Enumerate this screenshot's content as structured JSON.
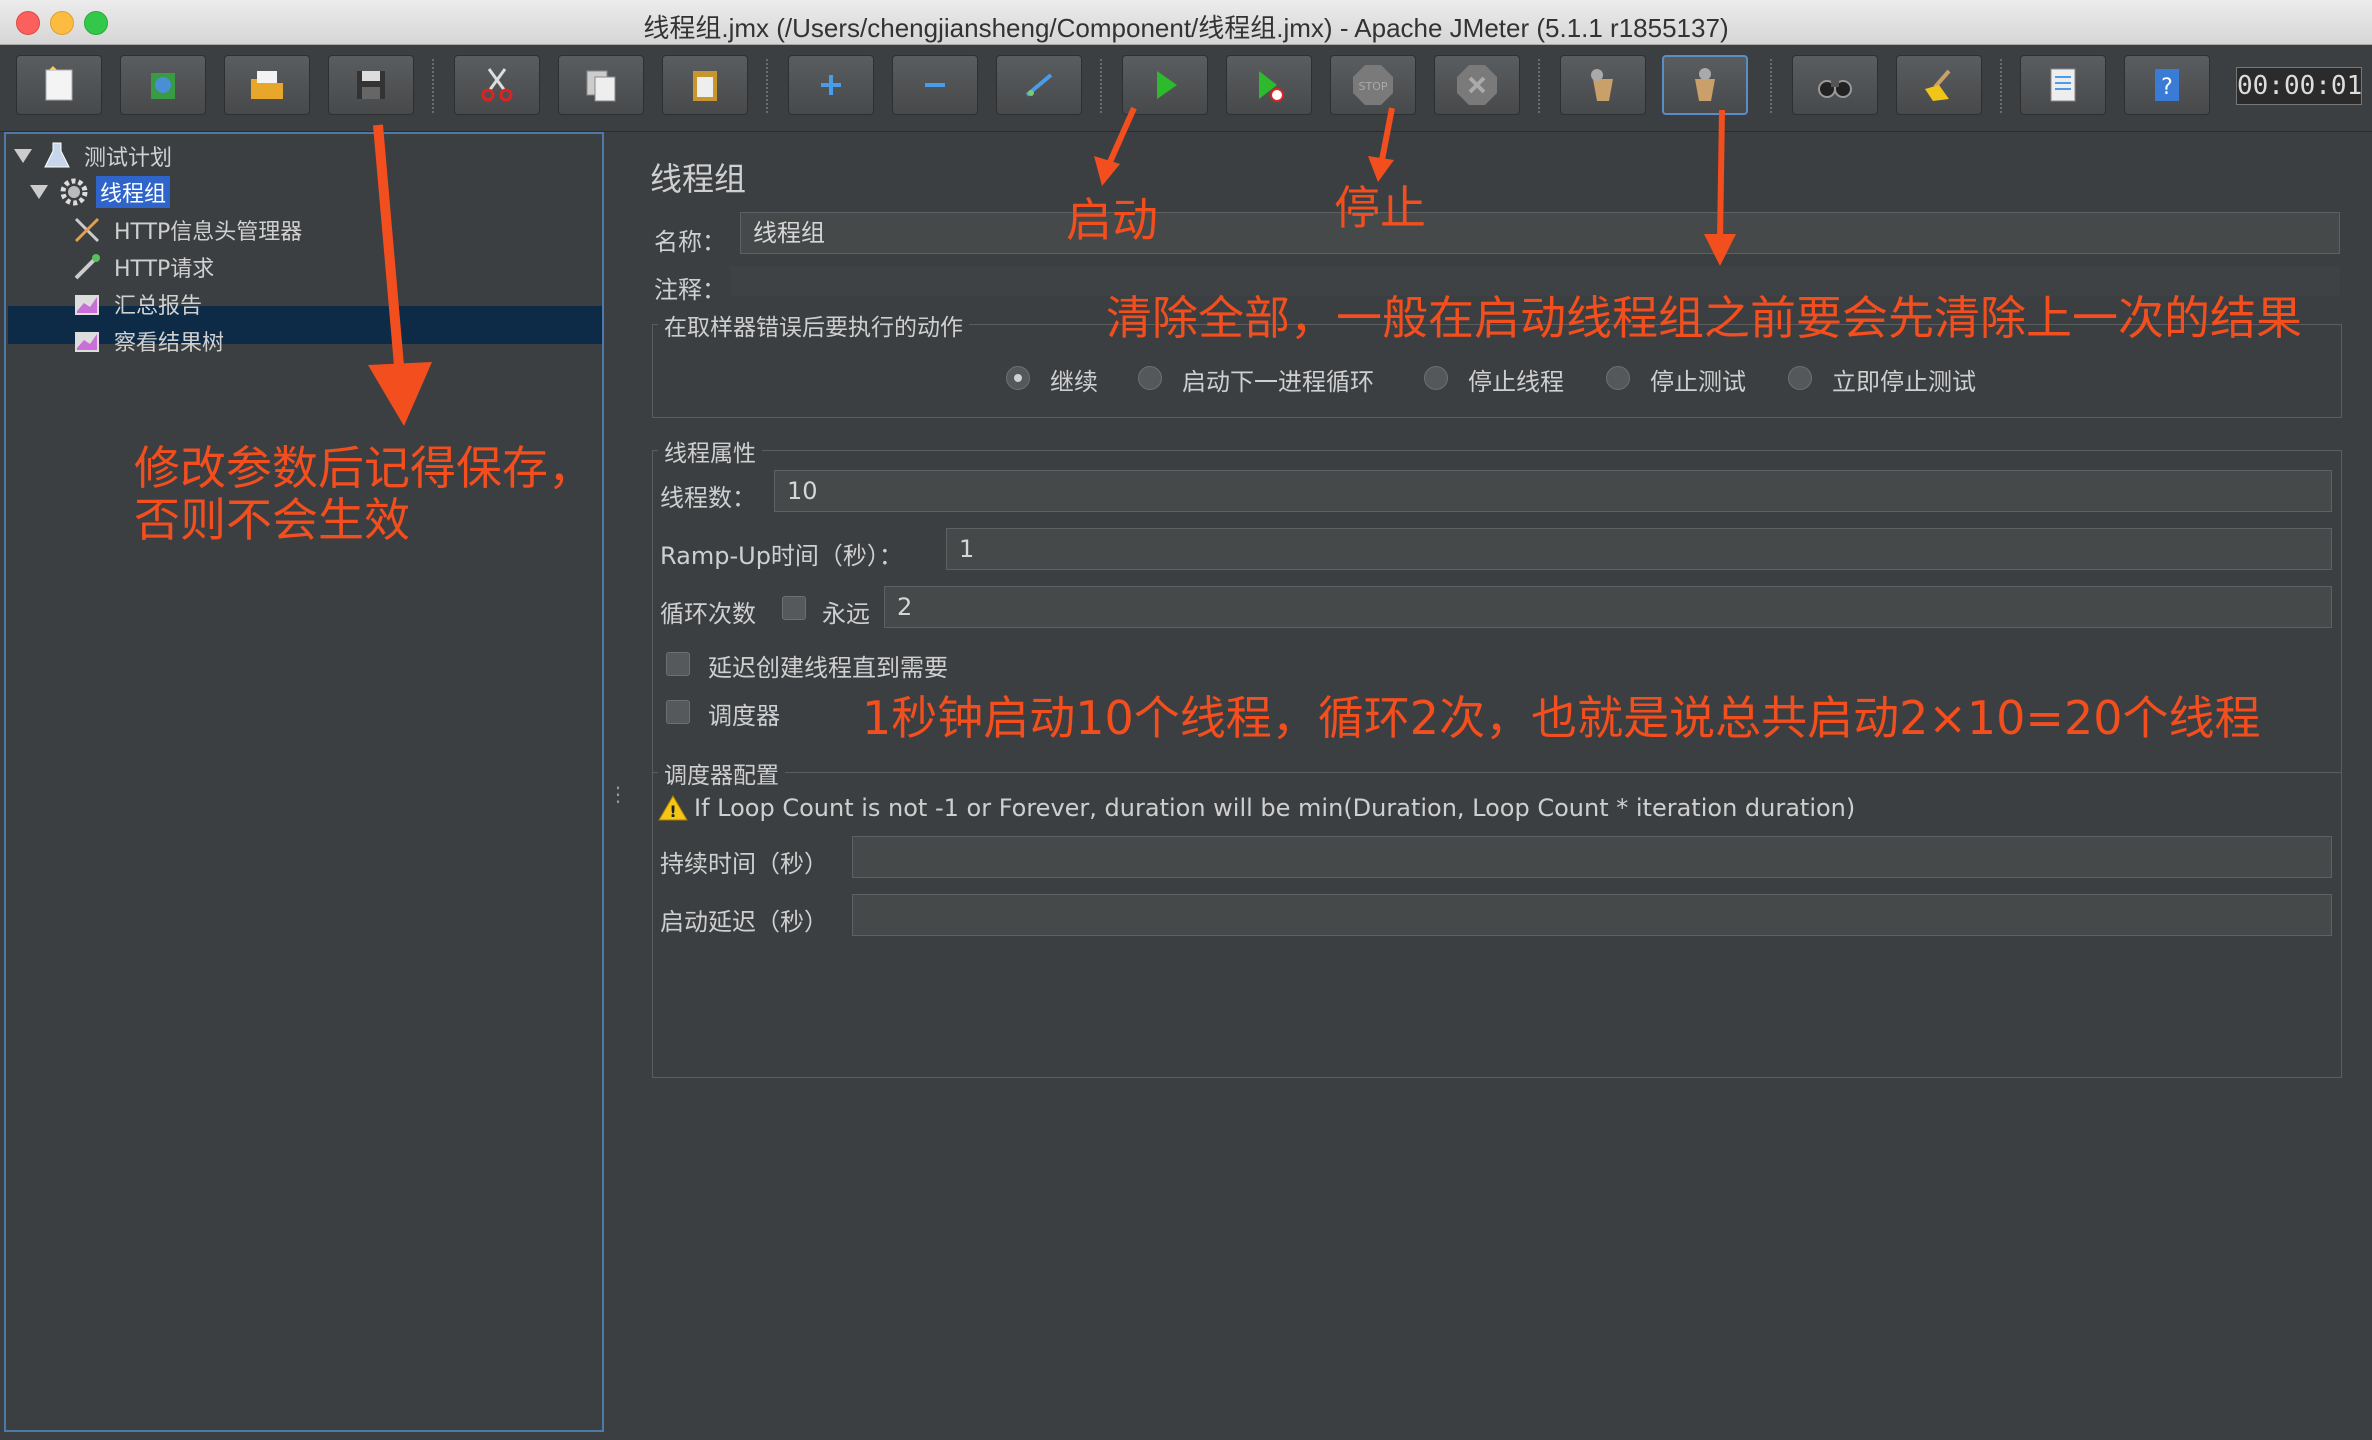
{
  "window": {
    "title": "线程组.jmx (/Users/chengjiansheng/Component/线程组.jmx) - Apache JMeter (5.1.1 r1855137)"
  },
  "toolbar": {
    "timer": "00:00:01",
    "buttons": [
      {
        "name": "new-icon"
      },
      {
        "name": "templates-icon"
      },
      {
        "name": "open-icon"
      },
      {
        "name": "save-icon"
      },
      {
        "name": "cut-icon"
      },
      {
        "name": "copy-icon"
      },
      {
        "name": "paste-icon"
      },
      {
        "name": "expand-icon"
      },
      {
        "name": "collapse-icon"
      },
      {
        "name": "toggle-icon"
      },
      {
        "name": "start-icon"
      },
      {
        "name": "start-no-pauses-icon"
      },
      {
        "name": "stop-icon"
      },
      {
        "name": "shutdown-icon"
      },
      {
        "name": "clear-icon"
      },
      {
        "name": "clear-all-icon"
      },
      {
        "name": "search-icon"
      },
      {
        "name": "reset-search-icon"
      },
      {
        "name": "function-helper-icon"
      },
      {
        "name": "help-icon"
      }
    ]
  },
  "tree": {
    "items": [
      {
        "label": "测试计划",
        "icon": "flask-icon"
      },
      {
        "label": "线程组",
        "icon": "gear-icon"
      },
      {
        "label": "HTTP信息头管理器",
        "icon": "tools-icon"
      },
      {
        "label": "HTTP请求",
        "icon": "pipette-icon"
      },
      {
        "label": "汇总报告",
        "icon": "chart-icon"
      },
      {
        "label": "察看结果树",
        "icon": "chart-icon"
      }
    ]
  },
  "form": {
    "title": "线程组",
    "name_label": "名称：",
    "name_value": "线程组",
    "comment_label": "注释：",
    "comment_value": "",
    "error_group": {
      "legend": "在取样器错误后要执行的动作",
      "options": [
        "继续",
        "启动下一进程循环",
        "停止线程",
        "停止测试",
        "立即停止测试"
      ],
      "selected": "继续"
    },
    "thread_group": {
      "legend": "线程属性",
      "threads_label": "线程数：",
      "threads_value": "10",
      "rampup_label": "Ramp-Up时间（秒）：",
      "rampup_value": "1",
      "loop_label": "循环次数",
      "forever_label": "永远",
      "loop_value": "2",
      "delay_label": "延迟创建线程直到需要",
      "scheduler_label": "调度器"
    },
    "scheduler": {
      "legend": "调度器配置",
      "warning": "If Loop Count is not -1 or Forever, duration will be min(Duration, Loop Count * iteration duration)",
      "duration_label": "持续时间（秒）",
      "duration_value": "",
      "delay_label": "启动延迟（秒）",
      "delay_value": ""
    }
  },
  "annotations": {
    "save_note": "修改参数后记得保存，\n否则不会生效",
    "start": "启动",
    "stop": "停止",
    "clear_all": "清除全部，一般在启动线程组之前要会先清除上一次的结果",
    "threads_note": "1秒钟启动10个线程，循环2次，也就是说总共启动2×10=20个线程"
  },
  "colors": {
    "annotation": "#f24e1e",
    "selection": "#2f65ca",
    "background": "#3c3f41"
  }
}
